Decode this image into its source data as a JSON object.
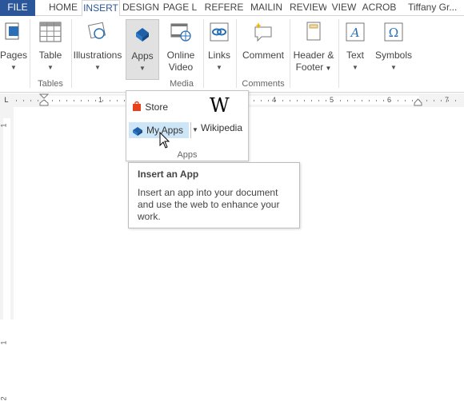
{
  "tabs": [
    "FILE",
    "HOME",
    "INSERT",
    "DESIGN",
    "PAGE L",
    "REFERE",
    "MAILIN",
    "REVIEW",
    "VIEW",
    "ACROB"
  ],
  "user": "Tiffany Gr...",
  "ribbon": {
    "pages": "Pages",
    "table": "Table",
    "illustrations": "Illustrations",
    "apps": "Apps",
    "online_video_1": "Online",
    "online_video_2": "Video",
    "links": "Links",
    "comment": "Comment",
    "header_footer_1": "Header &",
    "header_footer_2": "Footer",
    "text": "Text",
    "symbols": "Symbols"
  },
  "groups": {
    "tables": "Tables",
    "media": "Media",
    "comments": "Comments"
  },
  "ruler": {
    "tab_selector": "L",
    "numbers": [
      "1",
      "2",
      "4",
      "5",
      "6",
      "7"
    ],
    "vertical_numbers": [
      "1",
      "1",
      "2"
    ]
  },
  "apps_dropdown": {
    "store": "Store",
    "my_apps": "My Apps",
    "wikipedia_logo": "W",
    "wikipedia": "Wikipedia",
    "group_label": "Apps"
  },
  "tooltip": {
    "title": "Insert an App",
    "body": "Insert an app into your document and use the web to enhance your work."
  },
  "colors": {
    "file_tab": "#2b579a",
    "accent": "#2b579a",
    "hover": "#cde6f7",
    "store_icon": "#e8411b"
  }
}
